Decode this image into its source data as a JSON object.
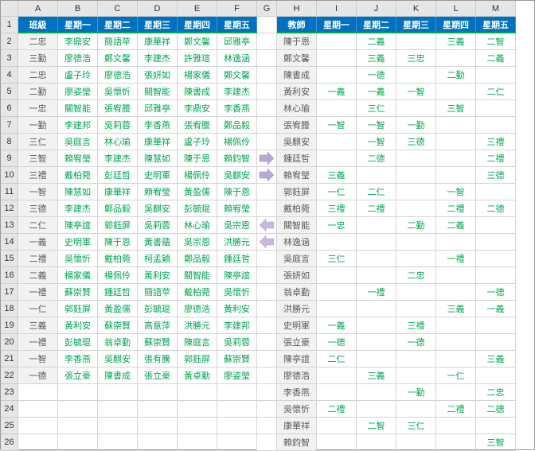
{
  "columns": [
    "A",
    "B",
    "C",
    "D",
    "E",
    "F",
    "G",
    "H",
    "I",
    "J",
    "K",
    "L",
    "M"
  ],
  "narrowCol": 6,
  "rowCount": 26,
  "leftHeader": [
    "班級",
    "星期一",
    "星期二",
    "星期三",
    "星期四",
    "星期五"
  ],
  "rightHeader": [
    "教師",
    "星期一",
    "星期二",
    "星期三",
    "星期四",
    "星期五"
  ],
  "leftRows": [
    [
      "二忠",
      "李鼎安",
      "簡語苹",
      "康華祥",
      "鄭文馨",
      "邱雅亭"
    ],
    [
      "三勤",
      "廖德浩",
      "鄭文馨",
      "李建杰",
      "許雅瑄",
      "林逸涵"
    ],
    [
      "二忠",
      "盧子玲",
      "廖德浩",
      "張妍如",
      "楊家儀",
      "鄭文馨"
    ],
    [
      "二勤",
      "廖姿瑩",
      "吳懷忻",
      "關智能",
      "陳書成",
      "李建杰"
    ],
    [
      "一忠",
      "關智能",
      "張宥謄",
      "邱雅亭",
      "李鼎安",
      "李香燕"
    ],
    [
      "一勤",
      "李建邦",
      "吳莉蓉",
      "李香燕",
      "張宥謄",
      "鄭品毅"
    ],
    [
      "三仁",
      "吳庭言",
      "林心瑜",
      "康華祥",
      "盧子玲",
      "楊佩伶"
    ],
    [
      "三智",
      "賴宥瑩",
      "李建杰",
      "陳慧如",
      "陳于恩",
      "賴鈞智"
    ],
    [
      "三禮",
      "戴柏菀",
      "彭廷哲",
      "史明軍",
      "楊佩伶",
      "吳麒安"
    ],
    [
      "一智",
      "陳慧如",
      "康華祥",
      "賴宥瑩",
      "黃盈儒",
      "陳于恩"
    ],
    [
      "三德",
      "李建杰",
      "鄭品毅",
      "吳麒安",
      "彭毓琨",
      "賴宥瑩"
    ],
    [
      "二仁",
      "陳亭誼",
      "郭鈺屏",
      "吳莉蓉",
      "林心瑜",
      "吳宗恩"
    ],
    [
      "一義",
      "史明軍",
      "陳于恩",
      "黃書蘊",
      "吳宗恩",
      "洪勝元"
    ],
    [
      "二禮",
      "吳懷忻",
      "戴柏菀",
      "柯孟穎",
      "鄭品毅",
      "鍾廷哲"
    ],
    [
      "二義",
      "楊家儀",
      "楊佩伶",
      "黃利安",
      "關智能",
      "陳亭誼"
    ],
    [
      "一禮",
      "蘇崇賢",
      "鍾廷哲",
      "簡語苹",
      "戴柏菀",
      "吳懷忻"
    ],
    [
      "一仁",
      "郭鈺屏",
      "黃盈儒",
      "彭毓琨",
      "廖德浩",
      "黃利安"
    ],
    [
      "三義",
      "黃利安",
      "蘇崇賢",
      "高意萍",
      "洪勝元",
      "李建邦"
    ],
    [
      "一禮",
      "彭毓琨",
      "翁卓勤",
      "蘇崇賢",
      "陳庭言",
      "吳莉蓉"
    ],
    [
      "一智",
      "李香燕",
      "吳麒安",
      "張有騰",
      "郭鈺屏",
      "蘇崇賢"
    ],
    [
      "一德",
      "張立豪",
      "陳書成",
      "張立豪",
      "黃卓勤",
      "廖姿瑩"
    ]
  ],
  "rightRows": [
    [
      "陳于恩",
      "",
      "二義",
      "",
      "三義",
      "二智"
    ],
    [
      "鄭文馨",
      "",
      "三義",
      "三忠",
      "",
      "二義"
    ],
    [
      "陳書成",
      "",
      "一德",
      "",
      "二勤",
      ""
    ],
    [
      "黃利安",
      "一義",
      "一義",
      "一智",
      "",
      "二仁"
    ],
    [
      "林心瑜",
      "",
      "三仁",
      "",
      "三智",
      ""
    ],
    [
      "張宥謄",
      "一智",
      "一智",
      "一勤",
      "",
      ""
    ],
    [
      "吳麒安",
      "",
      "一智",
      "三德",
      "",
      "三禮"
    ],
    [
      "鍾廷哲",
      "",
      "二德",
      "",
      "",
      "二禮"
    ],
    [
      "賴宥瑩",
      "三義",
      "",
      "",
      "",
      "三德"
    ],
    [
      "郭鈺屏",
      "一仁",
      "二仁",
      "",
      "一智",
      ""
    ],
    [
      "戴柏菀",
      "三禮",
      "二禮",
      "",
      "二禮",
      "二德"
    ],
    [
      "關智能",
      "一忠",
      "",
      "二勤",
      "二義",
      ""
    ],
    [
      "林逸涵",
      "",
      "",
      "",
      "",
      ""
    ],
    [
      "吳庭言",
      "三仁",
      "",
      "",
      "一禮",
      ""
    ],
    [
      "張妍如",
      "",
      "",
      "二忠",
      "",
      ""
    ],
    [
      "翁卓勤",
      "",
      "一禮",
      "",
      "",
      "一德"
    ],
    [
      "洪勝元",
      "",
      "",
      "",
      "三義",
      "一義"
    ],
    [
      "史明軍",
      "一義",
      "",
      "三禮",
      "",
      ""
    ],
    [
      "張立豪",
      "一德",
      "",
      "一德",
      "",
      ""
    ],
    [
      "陳亭誼",
      "二仁",
      "",
      "",
      "",
      "三義"
    ],
    [
      "廖德浩",
      "",
      "三義",
      "",
      "一仁",
      ""
    ],
    [
      "李香燕",
      "",
      "",
      "一勤",
      "",
      "二忠"
    ],
    [
      "吳懷忻",
      "二禮",
      "",
      "",
      "二禮",
      "二德"
    ],
    [
      "康華祥",
      "",
      "二智",
      "三仁",
      "",
      ""
    ],
    [
      "賴鈞智",
      "",
      "",
      "",
      "",
      "三智"
    ]
  ]
}
